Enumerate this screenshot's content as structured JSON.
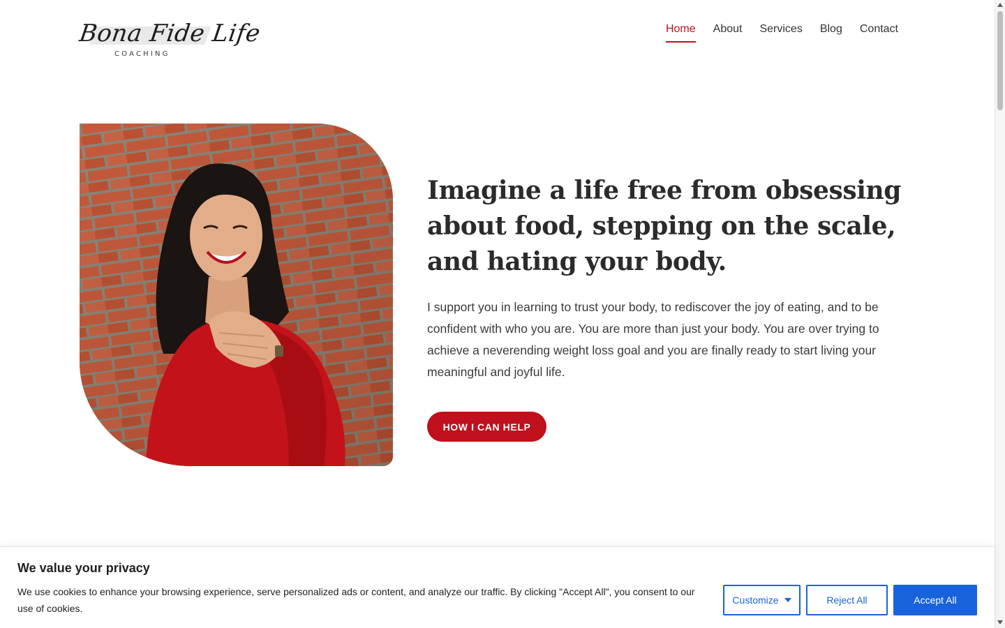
{
  "brand": {
    "logo_script": "Bona Fide Life",
    "logo_sub": "COACHING"
  },
  "nav": {
    "items": [
      {
        "label": "Home",
        "active": true
      },
      {
        "label": "About",
        "active": false
      },
      {
        "label": "Services",
        "active": false
      },
      {
        "label": "Blog",
        "active": false
      },
      {
        "label": "Contact",
        "active": false
      }
    ]
  },
  "hero": {
    "title": "Imagine a life free from obsessing about food, stepping on the scale, and hating your body.",
    "body": "I support you in learning to trust your body, to rediscover the joy of eating, and to be confident with who you are. You are more than just your body. You are over trying to achieve a neverending weight loss goal and you are finally ready to start living your meaningful and joyful life.",
    "cta_label": "HOW I CAN HELP"
  },
  "cookie": {
    "title": "We value your privacy",
    "text": "We use cookies to enhance your browsing experience, serve personalized ads or content, and analyze our traffic. By clicking \"Accept All\", you consent to our use of cookies.",
    "customize_label": "Customize",
    "reject_label": "Reject All",
    "accept_label": "Accept All"
  },
  "colors": {
    "accent": "#c0101c",
    "cookie_blue": "#1863dc",
    "text": "#333333"
  }
}
